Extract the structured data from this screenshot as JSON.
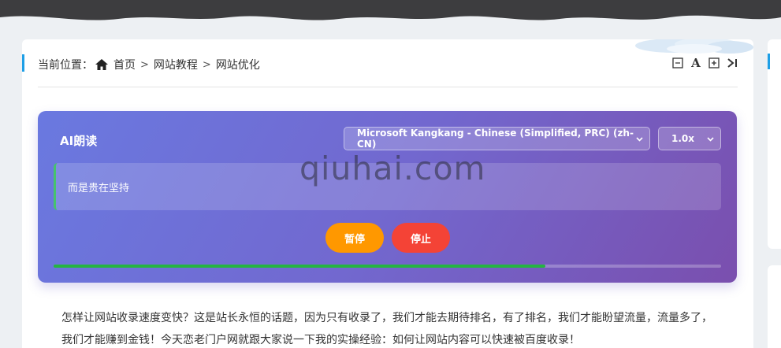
{
  "breadcrumb": {
    "label": "当前位置：",
    "items": [
      "首页",
      "网站教程",
      "网站优化"
    ],
    "separator": ">"
  },
  "tools": [
    "zoom-out",
    "font-size",
    "zoom-in",
    "collapse"
  ],
  "tools_labels": {
    "font": "A"
  },
  "tts": {
    "title": "AI朗读",
    "voice": "Microsoft Kangkang - Chinese (Simplified, PRC) (zh-CN)",
    "rate": "1.0x",
    "current_text": "而是贵在坚持",
    "pause_label": "暂停",
    "stop_label": "停止",
    "progress": 0.737
  },
  "watermark": "qiuhai.com",
  "article": {
    "paragraph": "怎样让网站收录速度变快？这是站长永恒的话题，因为只有收录了，我们才能去期待排名，有了排名，我们才能盼望流量，流量多了，我们才能赚到金钱！今天恋老门户网就跟大家说一下我的实操经验：如何让网站内容可以快速被百度收录！"
  },
  "colors": {
    "accent": "#1e9fe6",
    "pause": "#ff9800",
    "stop": "#f44336",
    "progress": "#25b442"
  }
}
